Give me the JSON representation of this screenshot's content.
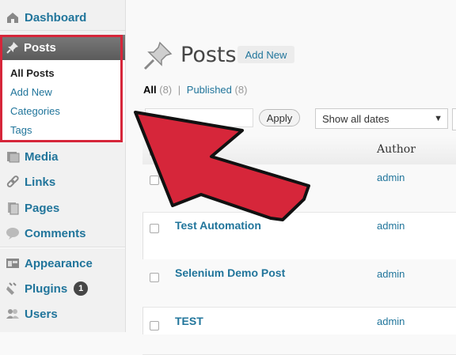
{
  "sidebar": {
    "dashboard": "Dashboard",
    "posts": "Posts",
    "submenu": [
      "All Posts",
      "Add New",
      "Categories",
      "Tags"
    ],
    "media": "Media",
    "links": "Links",
    "pages": "Pages",
    "comments": "Comments",
    "appearance": "Appearance",
    "plugins": "Plugins",
    "plugins_badge": "1",
    "users": "Users"
  },
  "main": {
    "title": "Posts",
    "add_new": "Add New",
    "filters": {
      "all": "All",
      "all_count": "(8)",
      "separator": "|",
      "published": "Published",
      "published_count": "(8)"
    },
    "apply": "Apply",
    "date_filter": "Show all dates",
    "column_author": "Author",
    "rows": [
      {
        "title": "",
        "author": "admin"
      },
      {
        "title": "Test Automation",
        "author": "admin"
      },
      {
        "title": "Selenium Demo Post",
        "author": "admin"
      },
      {
        "title": "TEST",
        "author": "admin"
      }
    ]
  },
  "colors": {
    "link": "#21759b",
    "highlight": "#d6263a",
    "arrow": "#d6263a"
  }
}
